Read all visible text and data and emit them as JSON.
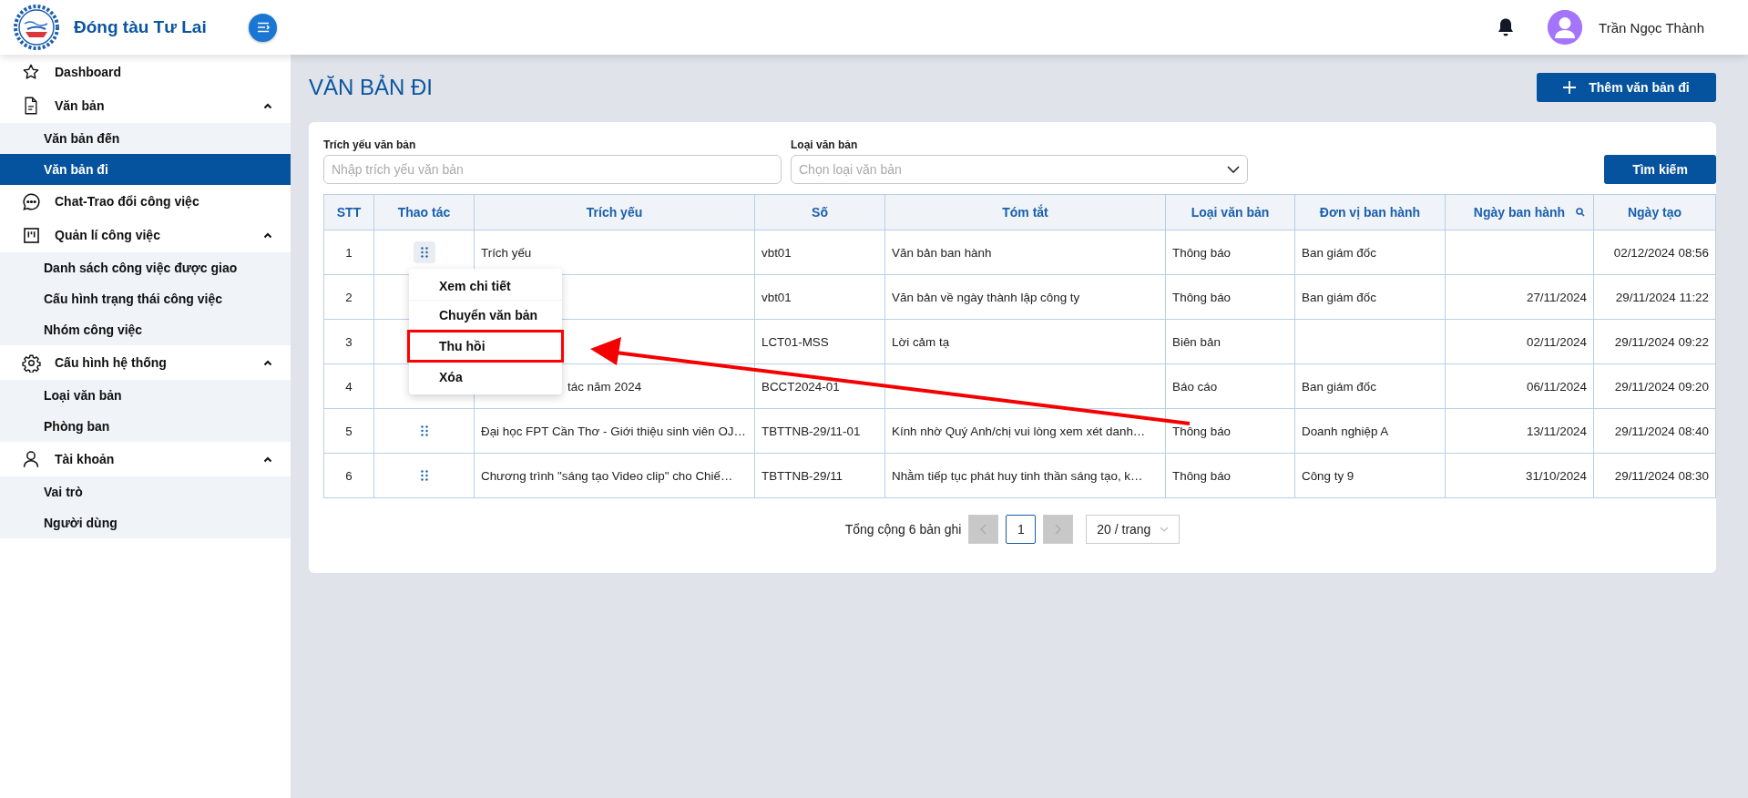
{
  "brand": {
    "title": "Đóng tàu Tư Lai"
  },
  "header": {
    "user_name": "Trần Ngọc Thành"
  },
  "sidebar": {
    "items": [
      {
        "kind": "link",
        "label": "Dashboard",
        "selected": false
      },
      {
        "kind": "group",
        "label": "Văn bản",
        "expanded": true,
        "children": [
          {
            "label": "Văn bản đến",
            "selected": false
          },
          {
            "label": "Văn bản đi",
            "selected": true
          }
        ]
      },
      {
        "kind": "link",
        "label": "Chat-Trao đổi công việc",
        "selected": false
      },
      {
        "kind": "group",
        "label": "Quản lí công việc",
        "expanded": true,
        "children": [
          {
            "label": "Danh sách công việc được giao",
            "selected": false
          },
          {
            "label": "Cấu hình trạng thái công việc",
            "selected": false
          },
          {
            "label": "Nhóm công việc",
            "selected": false
          }
        ]
      },
      {
        "kind": "group",
        "label": "Cấu hình hệ thống",
        "expanded": true,
        "children": [
          {
            "label": "Loại văn bản",
            "selected": false
          },
          {
            "label": "Phòng ban",
            "selected": false
          }
        ]
      },
      {
        "kind": "group",
        "label": "Tài khoản",
        "expanded": true,
        "children": [
          {
            "label": "Vai trò",
            "selected": false
          },
          {
            "label": "Người dùng",
            "selected": false
          }
        ]
      }
    ]
  },
  "page": {
    "title": "VĂN BẢN ĐI",
    "add_button": "Thêm văn bản đi"
  },
  "filters": {
    "summary": {
      "label": "Trích yếu văn bản",
      "placeholder": "Nhập trích yếu văn bản"
    },
    "type": {
      "label": "Loại văn bản",
      "placeholder": "Chọn loại văn bản"
    },
    "search_button": "Tìm kiếm"
  },
  "table": {
    "columns": [
      {
        "label": "STT",
        "search": false
      },
      {
        "label": "Thao tác",
        "search": false
      },
      {
        "label": "Trích yếu",
        "search": false
      },
      {
        "label": "Số",
        "search": false
      },
      {
        "label": "Tóm tắt",
        "search": false
      },
      {
        "label": "Loại văn bản",
        "search": false
      },
      {
        "label": "Đơn vị ban hành",
        "search": false
      },
      {
        "label": "Ngày ban hành",
        "search": true
      },
      {
        "label": "Ngày tạo",
        "search": false
      }
    ],
    "rows": [
      {
        "stt": "1",
        "trich_yeu": "Trích yếu",
        "so": "vbt01",
        "tom_tat": "Văn bản ban hành",
        "loai": "Thông báo",
        "don_vi": "Ban giám đốc",
        "ngay_tao": "02/12/2024 08:56"
      },
      {
        "stt": "2",
        "so": "vbt01",
        "tom_tat": "Văn bản về ngày thành lập công ty",
        "loai": "Thông báo",
        "don_vi": "Ban giám đốc",
        "ngay_ban_hanh": "27/11/2024",
        "ngay_tao": "29/11/2024 11:22"
      },
      {
        "stt": "3",
        "so": "LCT01-MSS",
        "tom_tat": "Lời cảm tạ",
        "loai": "Biên bản",
        "ngay_ban_hanh": "02/11/2024",
        "ngay_tao": "29/11/2024 09:22"
      },
      {
        "stt": "4",
        "trich_yeu": "tác năm 2024",
        "so": "BCCT2024-01",
        "loai": "Báo cáo",
        "don_vi": "Ban giám đốc",
        "ngay_ban_hanh": "06/11/2024",
        "ngay_tao": "29/11/2024 09:20"
      },
      {
        "stt": "5",
        "trich_yeu": "Đại học FPT Cần Thơ - Giới thiệu sinh viên OJ…",
        "so": "TBTTNB-29/11-01",
        "tom_tat": "Kính nhờ Quý Anh/chị vui lòng xem xét danh…",
        "loai": "Thông báo",
        "don_vi": "Doanh nghiệp A",
        "ngay_ban_hanh": "13/11/2024",
        "ngay_tao": "29/11/2024 08:40"
      },
      {
        "stt": "6",
        "trich_yeu": "Chương trình \"sáng tạo Video clip\" cho Chiế…",
        "so": "TBTTNB-29/11",
        "tom_tat": "Nhằm tiếp tục phát huy tinh thần sáng tạo, k…",
        "loai": "Thông báo",
        "don_vi": "Công ty 9",
        "ngay_ban_hanh": "31/10/2024",
        "ngay_tao": "29/11/2024 08:30"
      }
    ]
  },
  "action_menu": {
    "open": true,
    "items": [
      {
        "label": "Xem chi tiết",
        "highlighted": false
      },
      {
        "label": "Chuyển văn bản",
        "highlighted": false
      },
      {
        "label": "Thu hồi",
        "highlighted": true
      },
      {
        "label": "Xóa",
        "highlighted": false
      }
    ]
  },
  "pagination": {
    "total": "Tổng cộng 6 bản ghi",
    "prev_disabled": true,
    "page": "1",
    "next_disabled": true,
    "page_size": "20 / trang"
  }
}
